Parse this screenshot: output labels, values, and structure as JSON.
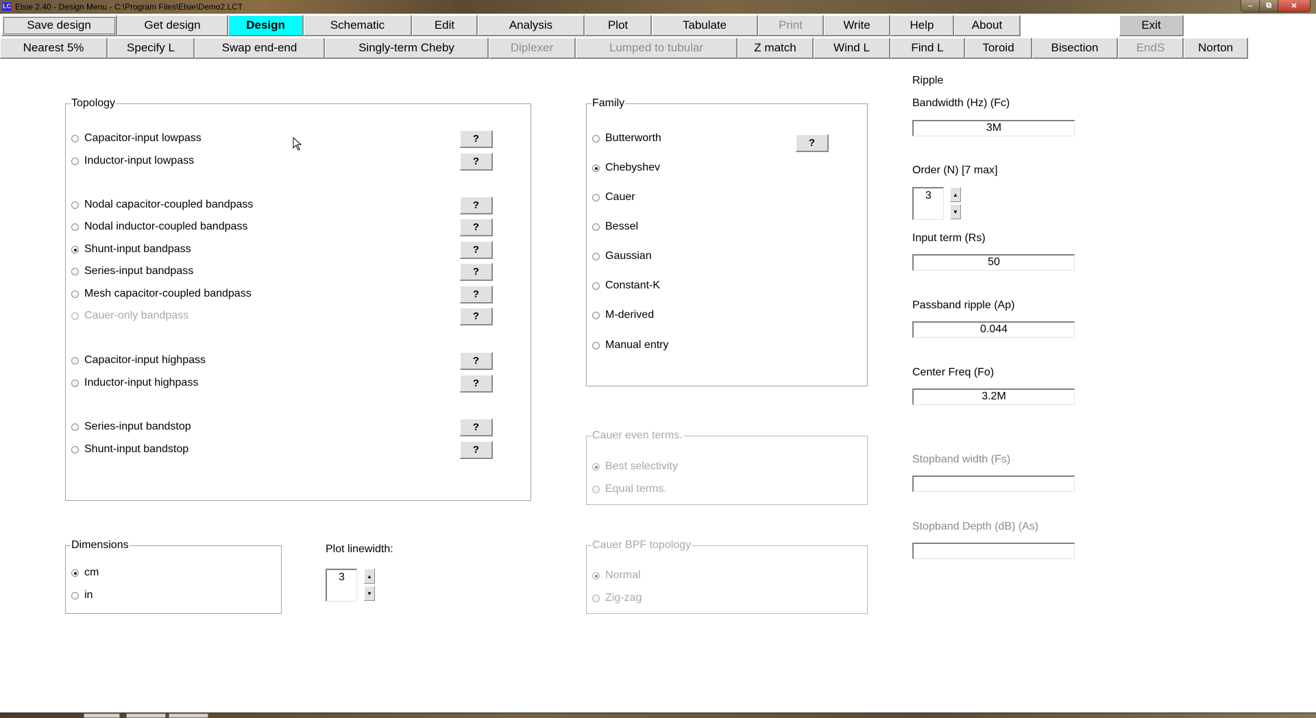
{
  "window": {
    "title": "Elsie 2.40 - Design Menu - C:\\Program Files\\Elsie\\Demo2.LCT",
    "app_icon_text": "LC",
    "controls": {
      "minimize": "–",
      "maximize": "⧉",
      "close": "✕"
    }
  },
  "menu_row1": [
    {
      "label": "Save design",
      "state": "focused"
    },
    {
      "label": "Get design",
      "state": "normal"
    },
    {
      "label": "Design",
      "state": "active"
    },
    {
      "label": "Schematic",
      "state": "normal"
    },
    {
      "label": "Edit",
      "state": "normal"
    },
    {
      "label": "Analysis",
      "state": "normal"
    },
    {
      "label": "Plot",
      "state": "normal"
    },
    {
      "label": "Tabulate",
      "state": "normal"
    },
    {
      "label": "Print",
      "state": "disabled"
    },
    {
      "label": "Write",
      "state": "normal"
    },
    {
      "label": "Help",
      "state": "normal"
    },
    {
      "label": "About",
      "state": "normal"
    },
    {
      "label": "Exit",
      "state": "exit"
    }
  ],
  "menu_row2": [
    {
      "label": "Nearest 5%",
      "state": "normal"
    },
    {
      "label": "Specify L",
      "state": "normal"
    },
    {
      "label": "Swap end-end",
      "state": "normal"
    },
    {
      "label": "Singly-term Cheby",
      "state": "normal"
    },
    {
      "label": "Diplexer",
      "state": "disabled"
    },
    {
      "label": "Lumped to tubular",
      "state": "disabled"
    },
    {
      "label": "Z match",
      "state": "normal"
    },
    {
      "label": "Wind L",
      "state": "normal"
    },
    {
      "label": "Find L",
      "state": "normal"
    },
    {
      "label": "Toroid",
      "state": "normal"
    },
    {
      "label": "Bisection",
      "state": "normal"
    },
    {
      "label": "EndS",
      "state": "disabled"
    },
    {
      "label": "Norton",
      "state": "normal"
    }
  ],
  "topology": {
    "title": "Topology",
    "help_label": "?",
    "options": [
      {
        "label": "Capacitor-input lowpass",
        "checked": false,
        "disabled": false
      },
      {
        "label": "Inductor-input lowpass",
        "checked": false,
        "disabled": false
      },
      {
        "label": "Nodal capacitor-coupled bandpass",
        "checked": false,
        "disabled": false
      },
      {
        "label": "Nodal inductor-coupled bandpass",
        "checked": false,
        "disabled": false
      },
      {
        "label": "Shunt-input bandpass",
        "checked": true,
        "disabled": false
      },
      {
        "label": "Series-input bandpass",
        "checked": false,
        "disabled": false
      },
      {
        "label": "Mesh capacitor-coupled bandpass",
        "checked": false,
        "disabled": false
      },
      {
        "label": "Cauer-only bandpass",
        "checked": false,
        "disabled": true
      },
      {
        "label": "Capacitor-input highpass",
        "checked": false,
        "disabled": false
      },
      {
        "label": "Inductor-input highpass",
        "checked": false,
        "disabled": false
      },
      {
        "label": "Series-input bandstop",
        "checked": false,
        "disabled": false
      },
      {
        "label": "Shunt-input bandstop",
        "checked": false,
        "disabled": false
      }
    ]
  },
  "family": {
    "title": "Family",
    "help_label": "?",
    "options": [
      {
        "label": "Butterworth",
        "checked": false
      },
      {
        "label": "Chebyshev",
        "checked": true
      },
      {
        "label": "Cauer",
        "checked": false
      },
      {
        "label": "Bessel",
        "checked": false
      },
      {
        "label": "Gaussian",
        "checked": false
      },
      {
        "label": "Constant-K",
        "checked": false
      },
      {
        "label": "M-derived",
        "checked": false
      },
      {
        "label": "Manual entry",
        "checked": false
      }
    ]
  },
  "cauer_even_terms": {
    "title": "Cauer even terms.",
    "disabled": true,
    "options": [
      {
        "label": "Best selectivity",
        "checked": true
      },
      {
        "label": "Equal terms.",
        "checked": false
      }
    ]
  },
  "cauer_bpf_topology": {
    "title": "Cauer BPF topology",
    "disabled": true,
    "options": [
      {
        "label": "Normal",
        "checked": true
      },
      {
        "label": "Zig-zag",
        "checked": false
      }
    ]
  },
  "dimensions": {
    "title": "Dimensions",
    "options": [
      {
        "label": "cm",
        "checked": true
      },
      {
        "label": "in",
        "checked": false
      }
    ]
  },
  "plot_linewidth": {
    "label": "Plot linewidth:",
    "value": "3"
  },
  "params": {
    "ripple_label": "Ripple",
    "bandwidth": {
      "label": "Bandwidth (Hz)  (Fc)",
      "value": "3M"
    },
    "order": {
      "label": "Order (N) [7 max]",
      "value": "3"
    },
    "input_term": {
      "label": "Input term  (Rs)",
      "value": "50"
    },
    "passband_ripple": {
      "label": "Passband ripple (Ap)",
      "value": "0.044"
    },
    "center_freq": {
      "label": "Center Freq  (Fo)",
      "value": "3.2M"
    },
    "stopband_width": {
      "label": "Stopband width  (Fs)",
      "value": "",
      "disabled": true
    },
    "stopband_depth": {
      "label": "Stopband Depth (dB) (As)",
      "value": "",
      "disabled": true
    }
  },
  "spinner": {
    "up": "▲",
    "down": "▼"
  }
}
